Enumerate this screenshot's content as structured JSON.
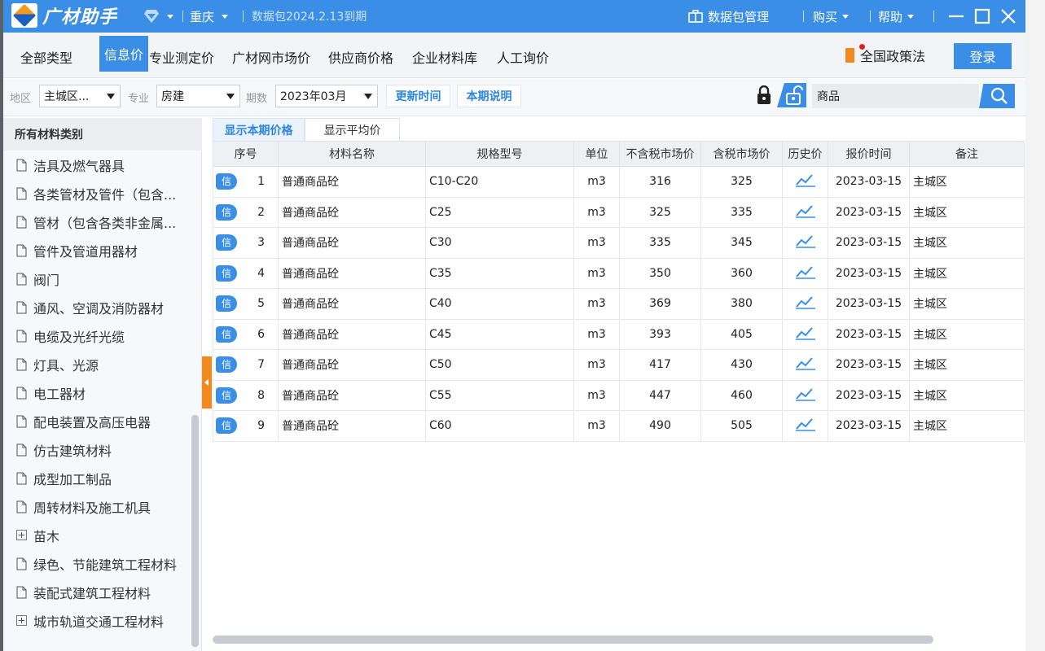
{
  "titlebar": {
    "app_name": "广材助手",
    "region": "重庆",
    "package_expiry": "数据包2024.2.13到期",
    "package_manage": "数据包管理",
    "buy": "购买",
    "help": "帮助"
  },
  "tabs": [
    {
      "label": "全部类型"
    },
    {
      "label": "信息价"
    },
    {
      "label": "专业测定价"
    },
    {
      "label": "广材网市场价"
    },
    {
      "label": "供应商价格"
    },
    {
      "label": "企业材料库"
    },
    {
      "label": "人工询价"
    }
  ],
  "policy_label": "全国政策法",
  "login_label": "登录",
  "filter": {
    "region_label": "地区",
    "region_value": "主城区...",
    "major_label": "专业",
    "major_value": "房建",
    "period_label": "期数",
    "period_value": "2023年03月",
    "update_time": "更新时间",
    "period_note": "本期说明",
    "search_value": "商品"
  },
  "sidebar": {
    "title": "所有材料类别",
    "items": [
      {
        "label": "洁具及燃气器具",
        "icon": "file-icon"
      },
      {
        "label": "各类管材及管件（包含...",
        "icon": "file-icon"
      },
      {
        "label": "管材（包含各类非金属...",
        "icon": "file-icon"
      },
      {
        "label": "管件及管道用器材",
        "icon": "file-icon"
      },
      {
        "label": "阀门",
        "icon": "file-icon"
      },
      {
        "label": "通风、空调及消防器材",
        "icon": "file-icon"
      },
      {
        "label": "电缆及光纤光缆",
        "icon": "file-icon"
      },
      {
        "label": "灯具、光源",
        "icon": "file-icon"
      },
      {
        "label": "电工器材",
        "icon": "file-icon"
      },
      {
        "label": "配电装置及高压电器",
        "icon": "file-icon"
      },
      {
        "label": "仿古建筑材料",
        "icon": "file-icon"
      },
      {
        "label": "成型加工制品",
        "icon": "file-icon"
      },
      {
        "label": "周转材料及施工机具",
        "icon": "file-icon"
      },
      {
        "label": "苗木",
        "icon": "expand-icon"
      },
      {
        "label": "绿色、节能建筑工程材料",
        "icon": "file-icon"
      },
      {
        "label": "装配式建筑工程材料",
        "icon": "file-icon"
      },
      {
        "label": "城市轨道交通工程材料",
        "icon": "expand-icon"
      }
    ]
  },
  "subtabs": {
    "current": "显示本期价格",
    "average": "显示平均价"
  },
  "table": {
    "headers": [
      "序号",
      "材料名称",
      "规格型号",
      "单位",
      "不含税市场价",
      "含税市场价",
      "历史价",
      "报价时间",
      "备注"
    ],
    "badge": "信",
    "rows": [
      {
        "no": "1",
        "name": "普通商品砼",
        "spec": "C10-C20",
        "unit": "m3",
        "pre_tax": "316",
        "with_tax": "325",
        "date": "2023-03-15",
        "note": "主城区"
      },
      {
        "no": "2",
        "name": "普通商品砼",
        "spec": "C25",
        "unit": "m3",
        "pre_tax": "325",
        "with_tax": "335",
        "date": "2023-03-15",
        "note": "主城区"
      },
      {
        "no": "3",
        "name": "普通商品砼",
        "spec": "C30",
        "unit": "m3",
        "pre_tax": "335",
        "with_tax": "345",
        "date": "2023-03-15",
        "note": "主城区"
      },
      {
        "no": "4",
        "name": "普通商品砼",
        "spec": "C35",
        "unit": "m3",
        "pre_tax": "350",
        "with_tax": "360",
        "date": "2023-03-15",
        "note": "主城区"
      },
      {
        "no": "5",
        "name": "普通商品砼",
        "spec": "C40",
        "unit": "m3",
        "pre_tax": "369",
        "with_tax": "380",
        "date": "2023-03-15",
        "note": "主城区"
      },
      {
        "no": "6",
        "name": "普通商品砼",
        "spec": "C45",
        "unit": "m3",
        "pre_tax": "393",
        "with_tax": "405",
        "date": "2023-03-15",
        "note": "主城区"
      },
      {
        "no": "7",
        "name": "普通商品砼",
        "spec": "C50",
        "unit": "m3",
        "pre_tax": "417",
        "with_tax": "430",
        "date": "2023-03-15",
        "note": "主城区"
      },
      {
        "no": "8",
        "name": "普通商品砼",
        "spec": "C55",
        "unit": "m3",
        "pre_tax": "447",
        "with_tax": "460",
        "date": "2023-03-15",
        "note": "主城区"
      },
      {
        "no": "9",
        "name": "普通商品砼",
        "spec": "C60",
        "unit": "m3",
        "pre_tax": "490",
        "with_tax": "505",
        "date": "2023-03-15",
        "note": "主城区"
      }
    ]
  },
  "colors": {
    "accent": "#3a8ee6",
    "orange": "#f08a1c"
  }
}
